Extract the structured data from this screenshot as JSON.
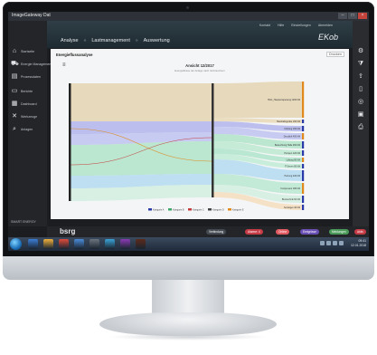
{
  "window": {
    "title": "ImageGateway Dat",
    "buttons": [
      "–",
      "□",
      "×"
    ]
  },
  "sidebar": {
    "items": [
      {
        "icon": "home-icon",
        "glyph": "⌂",
        "label": "Startseite"
      },
      {
        "icon": "truck-icon",
        "glyph": "⛟",
        "label": "Energie Management"
      },
      {
        "icon": "chart-icon",
        "glyph": "▤",
        "label": "Prozessdaten"
      },
      {
        "icon": "document-icon",
        "glyph": "▭",
        "label": "Berichte"
      },
      {
        "icon": "grid-icon",
        "glyph": "▦",
        "label": "Dashboard"
      },
      {
        "icon": "tools-icon",
        "glyph": "✕",
        "label": "Werkzeuge"
      },
      {
        "icon": "search-icon",
        "glyph": "⌕",
        "label": "Anlagen"
      }
    ],
    "footer_logo": "SMART ENERGY"
  },
  "header": {
    "top_links": [
      "Kontakt",
      "Hilfe",
      "Einstellungen",
      "Abmelden"
    ],
    "nav": [
      "Analyse",
      "Lastmanagement",
      "Auswertung"
    ],
    "brand": "EKob"
  },
  "rightbar": {
    "icons": [
      "settings-icon",
      "filter-icon",
      "share-icon",
      "document-icon",
      "circle-icon",
      "save-icon",
      "print-icon"
    ]
  },
  "content": {
    "title": "Energieflussanalyse",
    "export_label": "Drucken",
    "chart_title": "Ansicht 12/2017",
    "chart_subtitle": "Energieflüsse der Anlage nach Verbrauchern"
  },
  "chart_data": {
    "type": "sankey",
    "title": "Ansicht 12/2017",
    "targets": [
      {
        "label": "HG/1_Haupteinspeisung 1200 kW",
        "color": "#e3cfa7"
      },
      {
        "label": "Haushaltsgeräte 190 kW",
        "color": "#e8d4ad"
      },
      {
        "label": "Kühlung 150 kW",
        "color": "#a9ace9"
      },
      {
        "label": "Druckluft 400 kW",
        "color": "#b8bcf0"
      },
      {
        "label": "Beleuchtung Halle 260 kW",
        "color": "#a8e0c2"
      },
      {
        "label": "Pumpen 120 kW",
        "color": "#b6e7cc"
      },
      {
        "label": "Lüftung 90 kW",
        "color": "#a6e2c4"
      },
      {
        "label": "IT Server 80 kW",
        "color": "#b9e9d0"
      },
      {
        "label": "Heizung 240 kW",
        "color": "#acd7f0"
      },
      {
        "label": "Kompressor 180 kW",
        "color": "#b2e6cb"
      },
      {
        "label": "Bürotechnik 60 kW",
        "color": "#cfeedd"
      },
      {
        "label": "Sonstiges 40 kW",
        "color": "#f5d9b4"
      }
    ],
    "series": [
      {
        "name": "Kategorie A",
        "color": "#2a3aa8"
      },
      {
        "name": "Kategorie B",
        "color": "#3fa66a"
      },
      {
        "name": "Kategorie C",
        "color": "#c43a3a"
      },
      {
        "name": "Kategorie D",
        "color": "#444444"
      },
      {
        "name": "Kategorie E",
        "color": "#e08a1e"
      }
    ]
  },
  "bottombar": {
    "logo": "bsrg",
    "badges": [
      {
        "label": "Verbindung",
        "color": "#444a52"
      },
      {
        "label": "Alarme: 4",
        "color": "#c53b46"
      },
      {
        "label": "Online",
        "color": "#e35b62"
      },
      {
        "label": "Ereignisse",
        "color": "#6a4fb5"
      },
      {
        "label": "Meldungen",
        "color": "#4a9b5a"
      },
      {
        "label": "Aktiv",
        "color": "#c53b46"
      }
    ]
  },
  "taskbar": {
    "apps": [
      "#3b7ed6",
      "#f0b13c",
      "#e04b3b",
      "#4b8bd8",
      "#6c757f",
      "#3aa3d6",
      "#8c3bb5",
      "#5d2a1a"
    ],
    "clock_time": "09:41",
    "clock_date": "12.01.2018"
  }
}
